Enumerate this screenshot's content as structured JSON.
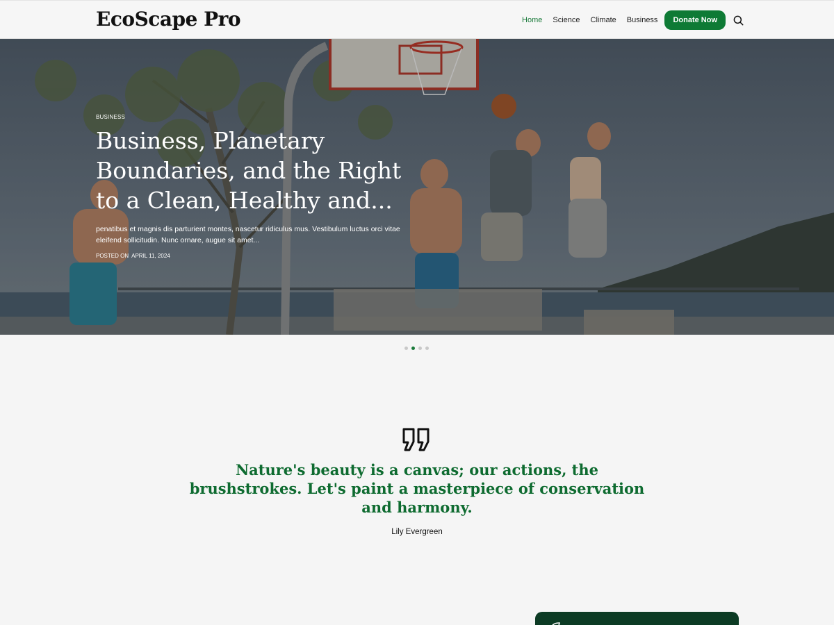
{
  "header": {
    "brand": "EcoScape Pro",
    "nav": [
      {
        "label": "Home",
        "active": true
      },
      {
        "label": "Science"
      },
      {
        "label": "Climate"
      },
      {
        "label": "Business"
      }
    ],
    "donate_label": "Donate Now",
    "search_icon": "search-icon"
  },
  "hero": {
    "category": "Business",
    "title": "Business, Planetary Boundaries, and the Right to a Clean, Healthy and...",
    "excerpt": "penatibus et magnis dis parturient montes, nascetur ridiculus mus. Vestibulum luctus orci vitae eleifend sollicitudin. Nunc ornare, augue sit amet...",
    "posted_label": "Posted on",
    "date": "April 11, 2024",
    "slides": 4,
    "active_slide": 2
  },
  "quote": {
    "icon": "quote-icon",
    "text": "Nature's beauty is a canvas; our actions, the brushstrokes. Let's paint a masterpiece of conservation and harmony.",
    "author": "Lily Evergreen"
  },
  "colors": {
    "accent": "#0e7a35",
    "quote_text": "#0e6b30",
    "card": "#0c3b24"
  }
}
